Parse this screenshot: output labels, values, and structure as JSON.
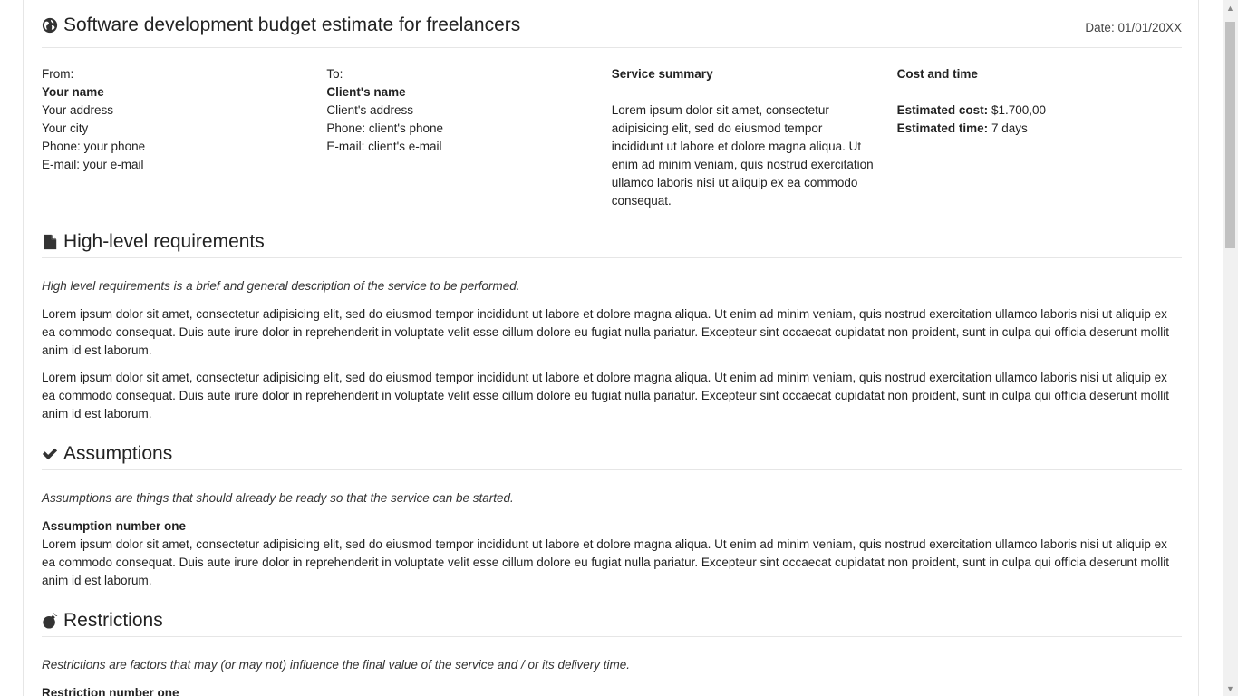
{
  "header": {
    "title": "Software development budget estimate for freelancers",
    "date": "Date: 01/01/20XX",
    "icon": "globe-icon"
  },
  "from": {
    "label": "From:",
    "name": "Your name",
    "address": "Your address",
    "city": "Your city",
    "phone": "Phone: your phone",
    "email": "E-mail: your e-mail"
  },
  "to": {
    "label": "To:",
    "name": "Client's name",
    "address": "Client's address",
    "phone": "Phone: client's phone",
    "email": "E-mail: client's e-mail"
  },
  "summary": {
    "heading": "Service summary",
    "text": "Lorem ipsum dolor sit amet, consectetur adipisicing elit, sed do eiusmod tempor incididunt ut labore et dolore magna aliqua. Ut enim ad minim veniam, quis nostrud exercitation ullamco laboris nisi ut aliquip ex ea commodo consequat."
  },
  "cost": {
    "heading": "Cost and time",
    "cost_label": "Estimated cost:",
    "cost_value": "$1.700,00",
    "time_label": "Estimated time:",
    "time_value": "7 days"
  },
  "requirements": {
    "heading": "High-level requirements",
    "icon": "file-icon",
    "intro": "High level requirements is a brief and general description of the service to be performed.",
    "p1": "Lorem ipsum dolor sit amet, consectetur adipisicing elit, sed do eiusmod tempor incididunt ut labore et dolore magna aliqua. Ut enim ad minim veniam, quis nostrud exercitation ullamco laboris nisi ut aliquip ex ea commodo consequat. Duis aute irure dolor in reprehenderit in voluptate velit esse cillum dolore eu fugiat nulla pariatur. Excepteur sint occaecat cupidatat non proident, sunt in culpa qui officia deserunt mollit anim id est laborum.",
    "p2": "Lorem ipsum dolor sit amet, consectetur adipisicing elit, sed do eiusmod tempor incididunt ut labore et dolore magna aliqua. Ut enim ad minim veniam, quis nostrud exercitation ullamco laboris nisi ut aliquip ex ea commodo consequat. Duis aute irure dolor in reprehenderit in voluptate velit esse cillum dolore eu fugiat nulla pariatur. Excepteur sint occaecat cupidatat non proident, sunt in culpa qui officia deserunt mollit anim id est laborum."
  },
  "assumptions": {
    "heading": "Assumptions",
    "icon": "check-icon",
    "intro": "Assumptions are things that should already be ready so that the service can be started.",
    "item1_title": "Assumption number one",
    "item1_text": "Lorem ipsum dolor sit amet, consectetur adipisicing elit, sed do eiusmod tempor incididunt ut labore et dolore magna aliqua. Ut enim ad minim veniam, quis nostrud exercitation ullamco laboris nisi ut aliquip ex ea commodo consequat. Duis aute irure dolor in reprehenderit in voluptate velit esse cillum dolore eu fugiat nulla pariatur. Excepteur sint occaecat cupidatat non proident, sunt in culpa qui officia deserunt mollit anim id est laborum."
  },
  "restrictions": {
    "heading": "Restrictions",
    "icon": "bomb-icon",
    "intro": "Restrictions are factors that may (or may not) influence the final value of the service and / or its delivery time.",
    "item1_title": "Restriction number one"
  }
}
